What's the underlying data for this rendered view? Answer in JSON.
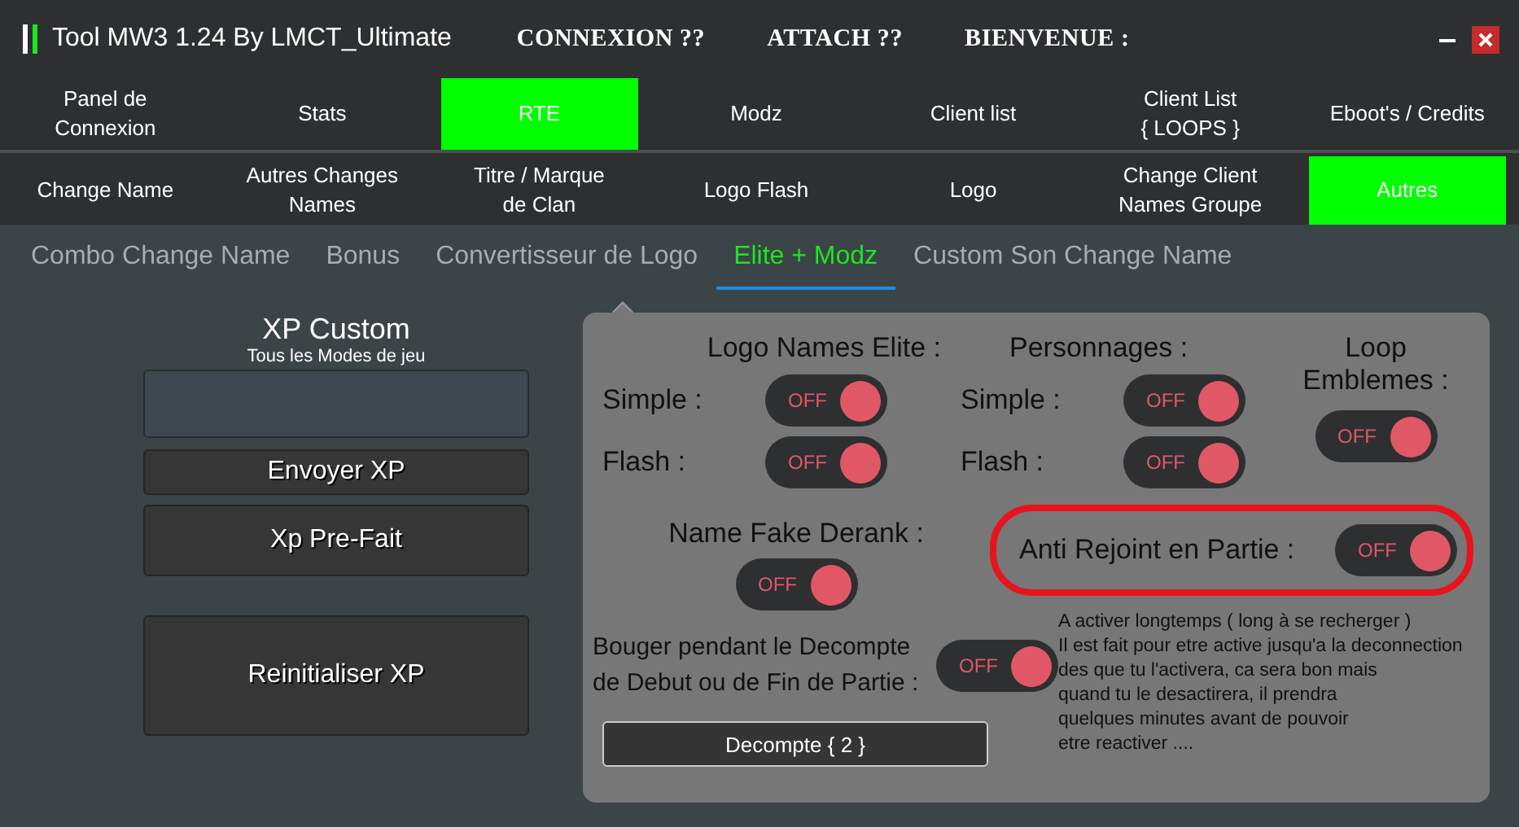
{
  "window": {
    "title": "Tool MW3 1.24 By LMCT_Ultimate",
    "status": [
      "CONNEXION ??",
      "ATTACH ??",
      "BIENVENUE :"
    ]
  },
  "nav_tabs": [
    {
      "label": "Panel de Connexion",
      "selected": false
    },
    {
      "label": "Stats",
      "selected": false
    },
    {
      "label": "RTE",
      "selected": true
    },
    {
      "label": "Modz",
      "selected": false
    },
    {
      "label": "Client list",
      "selected": false
    },
    {
      "label": "Client List { LOOPS }",
      "selected": false
    },
    {
      "label": "Eboot's / Credits",
      "selected": false
    }
  ],
  "sub_tabs": [
    {
      "label": "Change Name",
      "selected": false
    },
    {
      "label": "Autres Changes Names",
      "selected": false
    },
    {
      "label": "Titre / Marque de Clan",
      "selected": false
    },
    {
      "label": "Logo Flash",
      "selected": false
    },
    {
      "label": "Logo",
      "selected": false
    },
    {
      "label": "Change Client Names Groupe",
      "selected": false
    },
    {
      "label": "Autres",
      "selected": true
    }
  ],
  "mode_tabs": [
    {
      "label": "Combo Change Name",
      "selected": false
    },
    {
      "label": "Bonus",
      "selected": false
    },
    {
      "label": "Convertisseur de Logo",
      "selected": false
    },
    {
      "label": "Elite + Modz",
      "selected": true
    },
    {
      "label": "Custom Son Change Name",
      "selected": false
    }
  ],
  "xp_panel": {
    "title": "XP Custom",
    "subtitle": "Tous les Modes de jeu",
    "buttons": [
      "Envoyer XP",
      "Xp Pre-Fait",
      "Reinitialiser XP"
    ]
  },
  "elite_panel": {
    "groups": [
      {
        "title": "Logo Names Elite :",
        "rows": [
          {
            "label": "Simple :",
            "text": "OFF",
            "on": false
          },
          {
            "label": "Flash :",
            "text": "OFF",
            "on": false
          }
        ]
      },
      {
        "title": "Personnages :",
        "rows": [
          {
            "label": "Simple :",
            "text": "OFF",
            "on": false
          },
          {
            "label": "Flash :",
            "text": "OFF",
            "on": false
          }
        ]
      },
      {
        "title": "Loop Emblemes :",
        "rows": [
          {
            "text": "OFF",
            "on": false
          }
        ]
      }
    ],
    "name_fake_derank": {
      "label": "Name Fake Derank :",
      "text": "OFF",
      "on": false
    },
    "anti_rejoint": {
      "label": "Anti Rejoint en Partie :",
      "text": "OFF",
      "on": false,
      "highlighted": true
    },
    "bouger": {
      "label": "Bouger pendant le Decompte de Debut ou de Fin de Partie :",
      "text": "OFF",
      "on": false
    },
    "decompte_button": "Decompte { 2 }",
    "note": [
      "A activer longtemps ( long à se recherger )",
      "Il est fait pour etre active jusqu'a la deconnection",
      "des que tu l'activera, ca sera bon mais",
      "quand tu le desactirera, il prendra",
      "quelques minutes avant de pouvoir",
      "etre reactiver ...."
    ]
  }
}
